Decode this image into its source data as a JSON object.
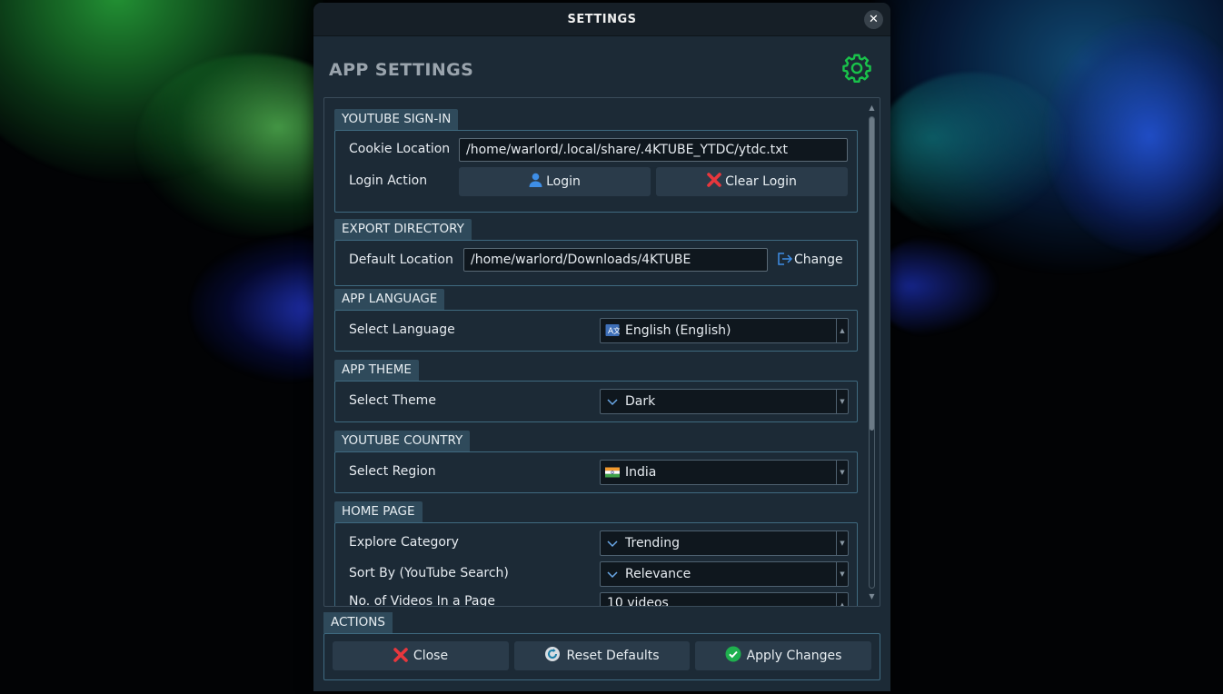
{
  "window": {
    "title": "SETTINGS"
  },
  "header": {
    "title": "APP SETTINGS",
    "icon": "gear-icon",
    "accent": "#19c24a"
  },
  "sections": {
    "signin": {
      "title": "YOUTUBE SIGN-IN",
      "cookie_label": "Cookie Location",
      "cookie_value": "/home/warlord/.local/share/.4KTUBE_YTDC/ytdc.txt",
      "login_label": "Login Action",
      "login_button": "Login",
      "clear_button": "Clear Login"
    },
    "export": {
      "title": "EXPORT DIRECTORY",
      "label": "Default Location",
      "value": "/home/warlord/Downloads/4KTUBE",
      "change_button": "Change"
    },
    "language": {
      "title": "APP LANGUAGE",
      "label": "Select Language",
      "value": "English (English)",
      "icon": "translate-icon"
    },
    "theme": {
      "title": "APP THEME",
      "label": "Select Theme",
      "value": "Dark",
      "icon": "chevron-down-icon"
    },
    "country": {
      "title": "YOUTUBE COUNTRY",
      "label": "Select Region",
      "value": "India",
      "icon": "india-flag-icon"
    },
    "home": {
      "title": "HOME PAGE",
      "explore_label": "Explore Category",
      "explore_value": "Trending",
      "sort_label": "Sort By (YouTube Search)",
      "sort_value": "Relevance",
      "videos_label": "No. of Videos In a Page",
      "videos_value": "10 videos"
    }
  },
  "actions": {
    "title": "ACTIONS",
    "close_button": "Close",
    "reset_button": "Reset Defaults",
    "apply_button": "Apply Changes"
  }
}
